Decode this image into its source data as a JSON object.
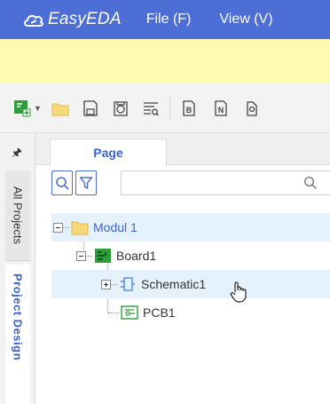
{
  "menubar": {
    "app_name": "EasyEDA",
    "menu": [
      {
        "label": "File (F)"
      },
      {
        "label": "View (V)"
      }
    ]
  },
  "panel": {
    "pin_icon": "pin-icon",
    "side_tabs": [
      {
        "label": "All Projects"
      },
      {
        "label": "Project Design"
      }
    ],
    "tab_label": "Page",
    "search": {
      "value": "",
      "placeholder": ""
    },
    "tree": [
      {
        "label": "Modul 1",
        "type": "folder",
        "expanded": true,
        "highlighted": true
      },
      {
        "label": "Board1",
        "type": "board",
        "expanded": true
      },
      {
        "label": "Schematic1",
        "type": "schematic",
        "expanded": false,
        "hovered": true
      },
      {
        "label": "PCB1",
        "type": "pcb"
      }
    ]
  },
  "colors": {
    "menubar": "#4d6ed4",
    "notice": "#fdfbb3",
    "accent": "#3d63c7",
    "pcb_green": "#2e9e3a",
    "highlight": "#e5f1fb"
  }
}
